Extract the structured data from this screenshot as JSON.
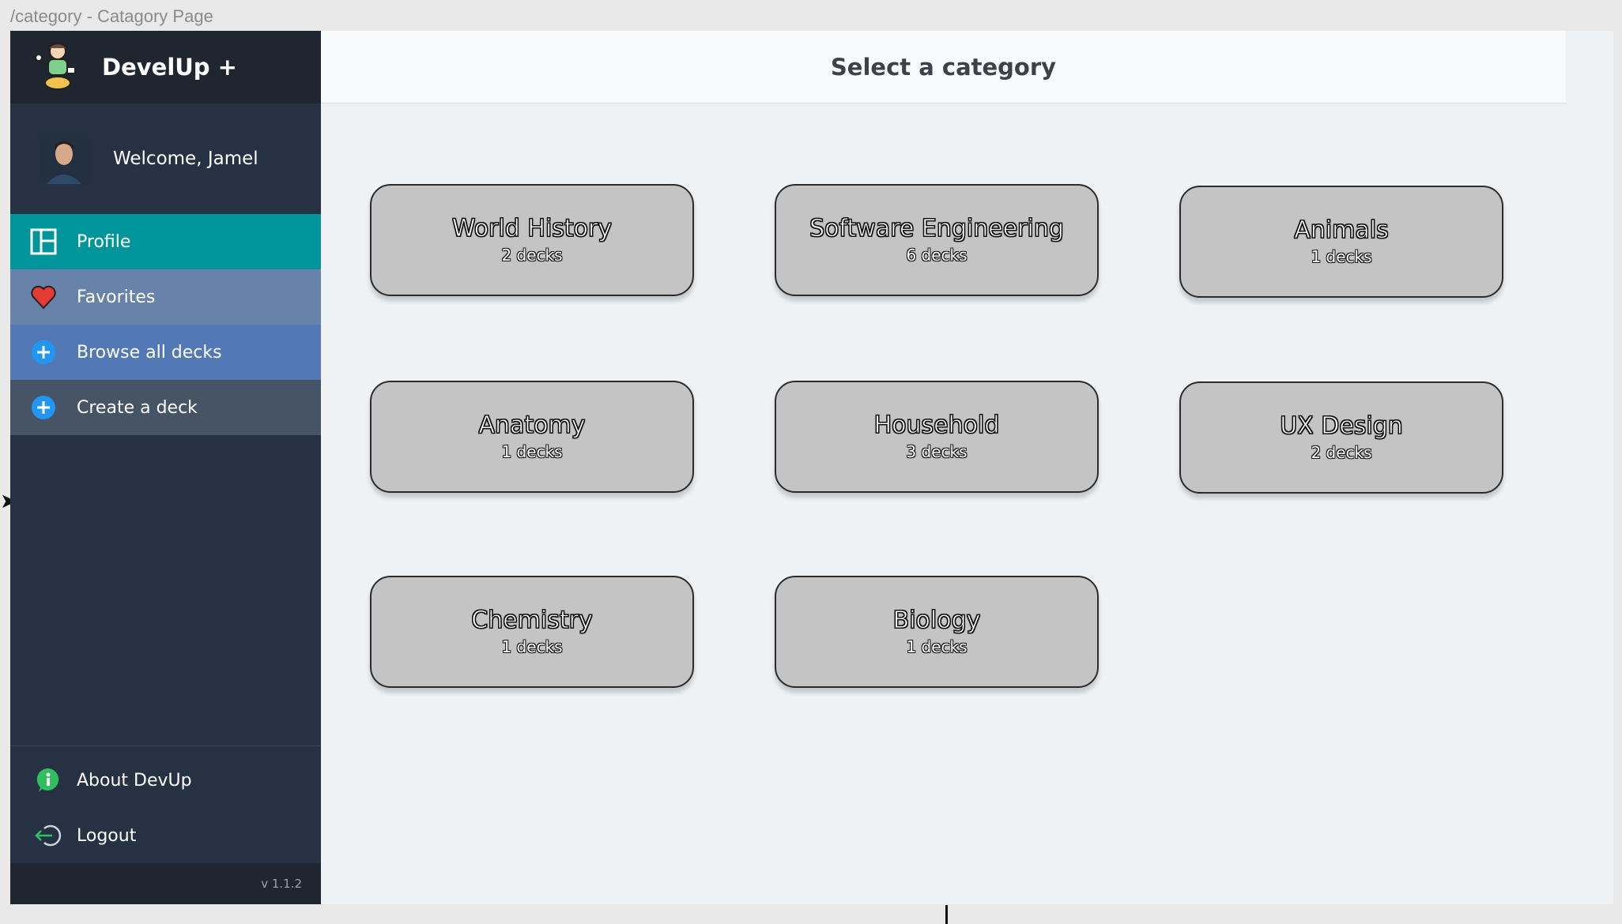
{
  "frame": {
    "label": "/category - Catagory Page"
  },
  "brand": {
    "title": "DevelUp +",
    "logo_icon": "mascot-logo-icon"
  },
  "user": {
    "welcome": "Welcome, Jamel",
    "avatar_icon": "user-avatar"
  },
  "nav": [
    {
      "label": "Profile",
      "icon": "layout-icon",
      "color": "#00959a"
    },
    {
      "label": "Favorites",
      "icon": "heart-icon",
      "color": "#6883a9"
    },
    {
      "label": "Browse all decks",
      "icon": "plus-circle-icon",
      "color": "#5279b5"
    },
    {
      "label": "Create a deck",
      "icon": "plus-circle-icon",
      "color": "#475466"
    }
  ],
  "bottom_nav": [
    {
      "label": "About DevUp",
      "icon": "info-icon"
    },
    {
      "label": "Logout",
      "icon": "logout-icon"
    }
  ],
  "version": "v 1.1.2",
  "header": {
    "title": "Select a category"
  },
  "categories": [
    {
      "name": "World History",
      "decks": "2 decks"
    },
    {
      "name": "Software Engineering",
      "decks": "6 decks"
    },
    {
      "name": "Animals",
      "decks": "1 decks"
    },
    {
      "name": "Anatomy",
      "decks": "1 decks"
    },
    {
      "name": "Household",
      "decks": "3 decks"
    },
    {
      "name": "UX Design",
      "decks": "2 decks"
    },
    {
      "name": "Chemistry",
      "decks": "1 decks"
    },
    {
      "name": "Biology",
      "decks": "1 decks"
    }
  ],
  "colors": {
    "sidebar_bg": "#263243",
    "brand_bg": "#1f2630",
    "card_bg": "#c4c4c4",
    "main_bg": "#eff2f5"
  }
}
